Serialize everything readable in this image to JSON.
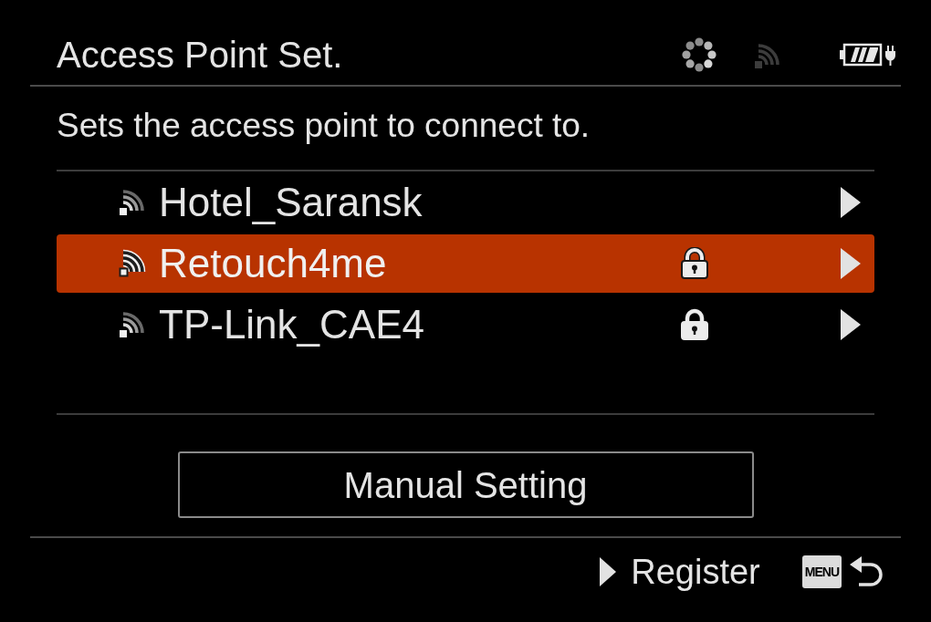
{
  "header": {
    "title": "Access Point Set."
  },
  "description": "Sets the access point to connect to.",
  "networks": [
    {
      "name": "Hotel_Saransk",
      "locked": false,
      "selected": false
    },
    {
      "name": "Retouch4me",
      "locked": true,
      "selected": true
    },
    {
      "name": "TP-Link_CAE4",
      "locked": true,
      "selected": false
    }
  ],
  "manual_button": {
    "label": "Manual Setting"
  },
  "footer": {
    "hint": "Register",
    "menu_key": "MENU"
  }
}
